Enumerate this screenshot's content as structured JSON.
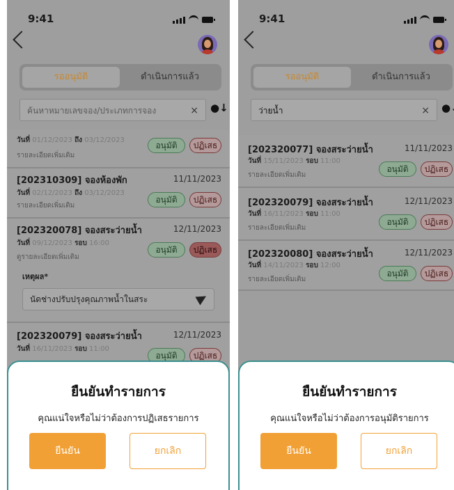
{
  "status_time": "9:41",
  "tabs": {
    "pending": "รออนุมัติ",
    "done": "ดำเนินการแล้ว"
  },
  "labels": {
    "day": "วันที่",
    "to": "ถึง",
    "round": "รอบ",
    "details": "รายละเอียดเพิ่มเติม",
    "details_alt": "ดูรายละเอียดเพิ่มเติม",
    "approve": "อนุมัติ",
    "reject": "ปฏิเสธ",
    "reason": "เหตุผล*",
    "sort_icon": "●↓",
    "clear_icon": "×"
  },
  "left_screen": {
    "search_placeholder": "ค้นหาหมายเลขจอง/ประเภทการจอง",
    "partial_item": {
      "day_value": "01/12/2023",
      "to_value": "03/12/2023"
    },
    "items": [
      {
        "title": "[202310309] จองห้องพัก",
        "date": "11/11/2023",
        "day_value": "02/12/2023",
        "to_value": "03/12/2023"
      },
      {
        "title": "[202320078] จองสระว่ายน้ำ",
        "date": "12/11/2023",
        "day_value": "09/12/2023",
        "round_value": "16:00",
        "reason_value": "นัดช่างปรับปรุงคุณภาพน้ำในสระ"
      },
      {
        "title": "[202320079] จองสระว่ายน้ำ",
        "date": "12/11/2023",
        "day_value": "16/11/2023",
        "round_value": "11:00"
      }
    ],
    "modal": {
      "title": "ยืนยันทำรายการ",
      "subtitle": "คุณแน่ใจหรือไม่ว่าต้องการปฏิเสธรายการ",
      "confirm": "ยืนยัน",
      "cancel": "ยกเลิก"
    }
  },
  "right_screen": {
    "search_value": "ว่ายน้ำ",
    "items": [
      {
        "title": "[202320077] จองสระว่ายน้ำ",
        "date": "11/11/2023",
        "day_value": "15/11/2023",
        "round_value": "11:00"
      },
      {
        "title": "[202320079] จองสระว่ายน้ำ",
        "date": "12/11/2023",
        "day_value": "16/11/2023",
        "round_value": "11:00"
      },
      {
        "title": "[202320080] จองสระว่ายน้ำ",
        "date": "12/11/2023",
        "day_value": "14/11/2023",
        "round_value": "12:00"
      }
    ],
    "modal": {
      "title": "ยืนยันทำรายการ",
      "subtitle": "คุณแน่ใจหรือไม่ว่าต้องการอนุมัติรายการ",
      "confirm": "ยืนยัน",
      "cancel": "ยกเลิก"
    }
  },
  "colors": {
    "accent": "#f1a035",
    "modal_border": "#3a8f8f",
    "approve": "#4b7a56",
    "reject": "#7a3a3a"
  }
}
